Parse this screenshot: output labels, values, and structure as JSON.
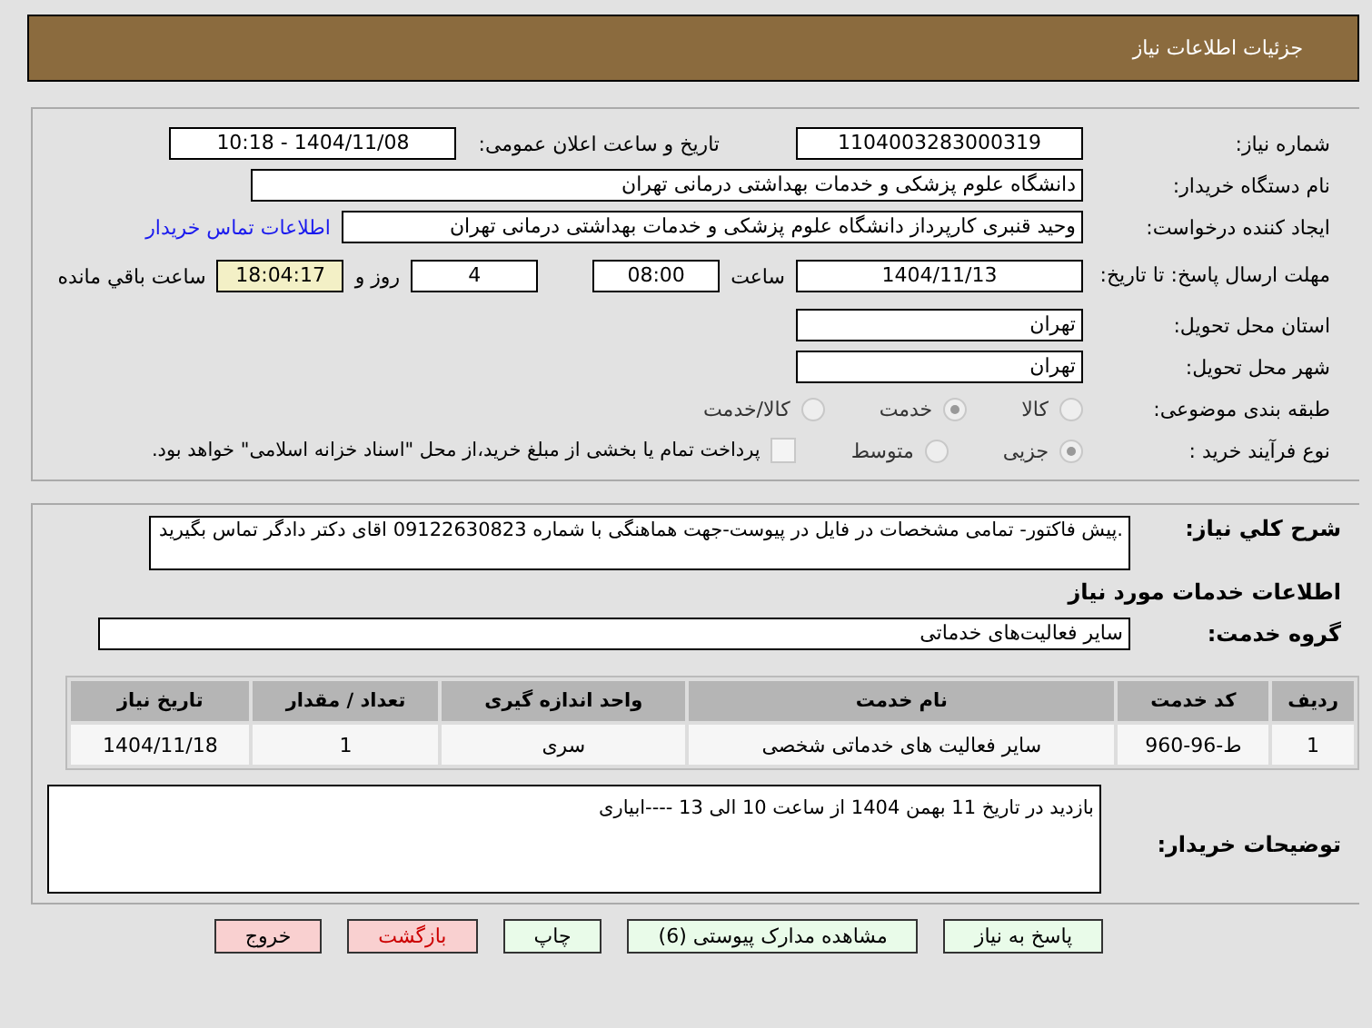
{
  "header": {
    "title": "جزئیات اطلاعات نیاز"
  },
  "need_number": {
    "label": "شماره نیاز:",
    "value": "1104003283000319"
  },
  "announce": {
    "label": "تاریخ و ساعت اعلان عمومی:",
    "value": "1404/11/08 - 10:18"
  },
  "buyer": {
    "label": "نام دستگاه خریدار:",
    "value": "دانشگاه علوم پزشکی و خدمات بهداشتی درمانی تهران"
  },
  "creator": {
    "label": "ایجاد کننده درخواست:",
    "value": "وحید قنبری کارپرداز دانشگاه علوم پزشکی و خدمات بهداشتی درمانی تهران",
    "link": "اطلاعات تماس خریدار"
  },
  "deadline": {
    "label": "مهلت ارسال پاسخ: تا تاریخ:",
    "date": "1404/11/13",
    "time_label": "ساعت",
    "time": "08:00",
    "days": "4",
    "days_label": "روز و",
    "remaining": "18:04:17",
    "remaining_label": "ساعت باقي مانده"
  },
  "province": {
    "label": "استان محل تحویل:",
    "value": "تهران"
  },
  "city": {
    "label": "شهر محل تحویل:",
    "value": "تهران"
  },
  "category": {
    "label": "طبقه بندی موضوعی:",
    "options": [
      {
        "label": "کالا",
        "selected": false
      },
      {
        "label": "خدمت",
        "selected": true
      },
      {
        "label": "کالا/خدمت",
        "selected": false
      }
    ]
  },
  "process": {
    "label": "نوع فرآیند خرید :",
    "options": [
      {
        "label": "جزیی",
        "selected": true
      },
      {
        "label": "متوسط",
        "selected": false
      }
    ],
    "payment": {
      "checked": false,
      "text": "پرداخت تمام یا بخشی از مبلغ خرید،از محل \"اسناد خزانه اسلامی\" خواهد بود."
    }
  },
  "description": {
    "label": "شرح کلي نیاز:",
    "value": ".پیش فاکتور- تمامی مشخصات در فایل در پیوست-جهت هماهنگی با شماره 09122630823 اقای دکتر دادگر تماس بگیرید"
  },
  "services_heading": "اطلاعات خدمات مورد نیاز",
  "service_group": {
    "label": "گروه خدمت:",
    "value": "سایر فعالیت‌های خدماتی"
  },
  "table": {
    "columns": [
      "ردیف",
      "کد خدمت",
      "نام خدمت",
      "واحد اندازه گیری",
      "تعداد / مقدار",
      "تاریخ نیاز"
    ],
    "rows": [
      [
        "1",
        "ط-96-960",
        "سایر فعالیت های خدماتی شخصی",
        "سری",
        "1",
        "1404/11/18"
      ]
    ]
  },
  "buyer_notes": {
    "label": "توضیحات خریدار:",
    "value": "بازدید در تاریخ 11 بهمن 1404 از ساعت 10 الی 13 ----ابیاری"
  },
  "buttons": [
    {
      "label": "پاسخ به نیاز",
      "kind": "primary"
    },
    {
      "label": "مشاهده مدارک پیوستی (6)",
      "kind": "primary"
    },
    {
      "label": "چاپ",
      "kind": "primary"
    },
    {
      "label": "بازگشت",
      "kind": "danger"
    },
    {
      "label": "خروج",
      "kind": "exit"
    }
  ]
}
